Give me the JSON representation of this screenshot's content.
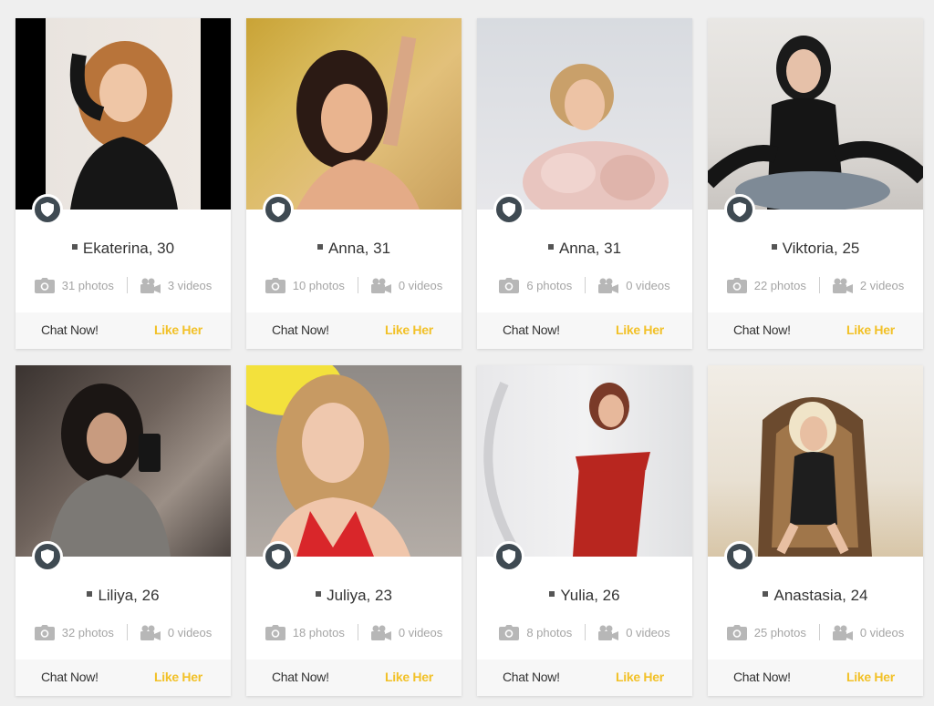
{
  "profiles": [
    {
      "name": "Ekaterina",
      "age_label": "Ekaterina, 30",
      "photos": "31 photos",
      "videos": "3 videos"
    },
    {
      "name": "Anna",
      "age_label": "Anna, 31",
      "photos": "10 photos",
      "videos": "0 videos"
    },
    {
      "name": "Anna",
      "age_label": "Anna, 31",
      "photos": "6 photos",
      "videos": "0 videos"
    },
    {
      "name": "Viktoria",
      "age_label": "Viktoria, 25",
      "photos": "22 photos",
      "videos": "2 videos"
    },
    {
      "name": "Liliya",
      "age_label": "Liliya, 26",
      "photos": "32 photos",
      "videos": "0 videos"
    },
    {
      "name": "Juliya",
      "age_label": "Juliya, 23",
      "photos": "18 photos",
      "videos": "0 videos"
    },
    {
      "name": "Yulia",
      "age_label": "Yulia, 26",
      "photos": "8 photos",
      "videos": "0 videos"
    },
    {
      "name": "Anastasia",
      "age_label": "Anastasia, 24",
      "photos": "25 photos",
      "videos": "0 videos"
    }
  ],
  "actions": {
    "chat_label": "Chat Now!",
    "like_label": "Like Her"
  },
  "colors": {
    "like": "#f2c128",
    "badge": "#3f4a52",
    "background": "#efefef"
  },
  "icons": {
    "badge": "shield-icon",
    "photos": "camera-icon",
    "videos": "video-camera-icon"
  }
}
